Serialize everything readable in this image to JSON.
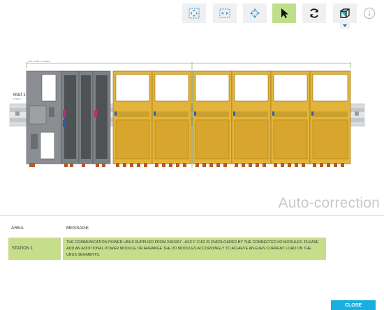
{
  "toolbar": {
    "buttons": [
      {
        "name": "fit-view-button",
        "icon": "fit-view-icon",
        "active": false
      },
      {
        "name": "fit-width-button",
        "icon": "fit-width-icon",
        "active": false
      },
      {
        "name": "pan-button",
        "icon": "pan-icon",
        "active": false
      },
      {
        "name": "select-button",
        "icon": "cursor-icon",
        "active": true
      },
      {
        "name": "refresh-button",
        "icon": "refresh-icon",
        "active": false
      },
      {
        "name": "view-3d-button",
        "icon": "cube-icon",
        "active": false
      }
    ],
    "info_icon": "info-icon"
  },
  "canvas": {
    "rail_label": "Rail 1",
    "rail_sub": "1750mm",
    "dimension_label": "AXC F 2152 + modules",
    "title": "Auto-correction",
    "colors": {
      "module_yellow": "#e4b43a",
      "module_gray": "#7d8084",
      "rail": "#cfd2d3",
      "dimension_line": "#3a9a3a",
      "connector": "#b45a28"
    }
  },
  "table": {
    "headers": {
      "area": "AREA",
      "message": "MESSAGE"
    },
    "rows": [
      {
        "area": "STATION 1",
        "message": "THE COMMUNICATION POWER UBUS SUPPLIED FROM 2404267 - AXC F 2152 IS OVERLOADED BY THE CONNECTED I/O MODULES. PLEASE ADD AN ADDITIONAL POWER MODULE OR ARRANGE THE I/O MODULES ACCORDINGLY TO ACHIEVE AN EVEN CURRENT LOAD ON THE UBUS SEGMENTS."
      }
    ],
    "row_color": "#c6de8c"
  },
  "footer": {
    "close_label": "CLOSE",
    "close_color": "#19aee0"
  }
}
